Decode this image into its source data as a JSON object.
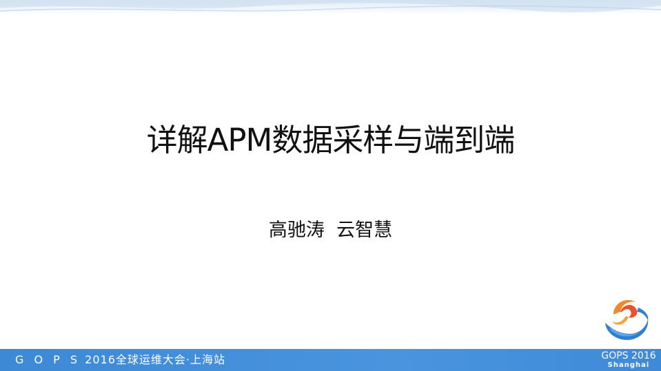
{
  "slide": {
    "title": "详解APM数据采样与端到端",
    "author": "高驰涛  云智慧"
  },
  "footer": {
    "event_prefix": "G O P S",
    "event_name": "2016全球运维大会·上海站"
  },
  "brand": {
    "name": "GOPS 2016",
    "city": "Shanghai"
  },
  "colors": {
    "footer_blue": "#4a94de",
    "logo_orange": "#e9532b",
    "logo_blue": "#2d7fd0"
  }
}
